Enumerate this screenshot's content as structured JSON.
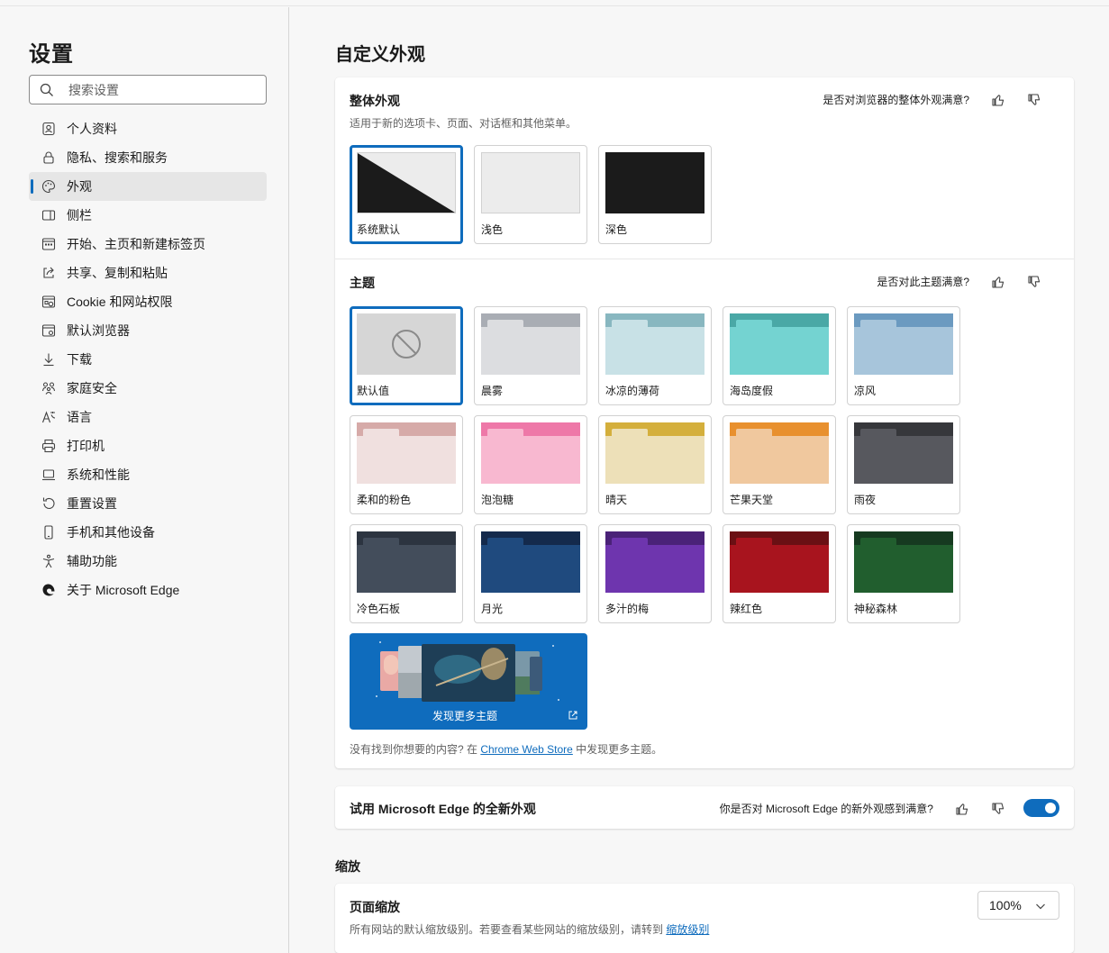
{
  "sidebar": {
    "title": "设置",
    "search_placeholder": "搜索设置",
    "items": [
      {
        "label": "个人资料",
        "icon": "profile-icon"
      },
      {
        "label": "隐私、搜索和服务",
        "icon": "lock-icon"
      },
      {
        "label": "外观",
        "icon": "palette-icon",
        "active": true
      },
      {
        "label": "侧栏",
        "icon": "sidebar-icon"
      },
      {
        "label": "开始、主页和新建标签页",
        "icon": "home-grid-icon"
      },
      {
        "label": "共享、复制和粘贴",
        "icon": "share-icon"
      },
      {
        "label": "Cookie 和网站权限",
        "icon": "cookie-icon"
      },
      {
        "label": "默认浏览器",
        "icon": "browser-icon"
      },
      {
        "label": "下载",
        "icon": "download-icon"
      },
      {
        "label": "家庭安全",
        "icon": "family-icon"
      },
      {
        "label": "语言",
        "icon": "language-icon"
      },
      {
        "label": "打印机",
        "icon": "printer-icon"
      },
      {
        "label": "系统和性能",
        "icon": "laptop-icon"
      },
      {
        "label": "重置设置",
        "icon": "reset-icon"
      },
      {
        "label": "手机和其他设备",
        "icon": "phone-icon"
      },
      {
        "label": "辅助功能",
        "icon": "accessibility-icon"
      },
      {
        "label": "关于 Microsoft Edge",
        "icon": "edge-logo-icon"
      }
    ]
  },
  "main": {
    "title": "自定义外观",
    "overall": {
      "title": "整体外观",
      "subtitle": "适用于新的选项卡、页面、对话框和其他菜单。",
      "feedback": "是否对浏览器的整体外观满意?",
      "options": [
        {
          "label": "系统默认",
          "selected": true
        },
        {
          "label": "浅色"
        },
        {
          "label": "深色"
        }
      ]
    },
    "themes": {
      "title": "主题",
      "feedback": "是否对此主题满意?",
      "items": [
        {
          "label": "默认值",
          "selected": true,
          "default": true
        },
        {
          "label": "晨雾",
          "bar": "#a9adb4",
          "body": "#dcdde0",
          "tab": "#dcdde0"
        },
        {
          "label": "冰凉的薄荷",
          "bar": "#88b7c0",
          "body": "#c8e1e6",
          "tab": "#c8e1e6"
        },
        {
          "label": "海岛度假",
          "bar": "#4aa8a6",
          "body": "#74d3d1",
          "tab": "#74d3d1"
        },
        {
          "label": "凉风",
          "bar": "#6b9ac0",
          "body": "#a7c5db",
          "tab": "#a7c5db"
        },
        {
          "label": "柔和的粉色",
          "bar": "#d6aaa8",
          "body": "#f0e0df",
          "tab": "#f0e0df"
        },
        {
          "label": "泡泡糖",
          "bar": "#ee78a8",
          "body": "#f8b8d0",
          "tab": "#f8b8d0"
        },
        {
          "label": "晴天",
          "bar": "#d4af3c",
          "body": "#ede0b8",
          "tab": "#ede0b8"
        },
        {
          "label": "芒果天堂",
          "bar": "#e8902e",
          "body": "#f0c89e",
          "tab": "#f0c89e"
        },
        {
          "label": "雨夜",
          "bar": "#36373b",
          "body": "#57585e",
          "tab": "#57585e"
        },
        {
          "label": "冷色石板",
          "bar": "#2c3440",
          "body": "#434d5b",
          "tab": "#434d5b"
        },
        {
          "label": "月光",
          "bar": "#142a4c",
          "body": "#1f4a7e",
          "tab": "#1f4a7e"
        },
        {
          "label": "多汁的梅",
          "bar": "#4a2278",
          "body": "#6e35ae",
          "tab": "#6e35ae"
        },
        {
          "label": "辣红色",
          "bar": "#6a1014",
          "body": "#a8141e",
          "tab": "#a8141e"
        },
        {
          "label": "神秘森林",
          "bar": "#163a20",
          "body": "#215e2e",
          "tab": "#215e2e"
        }
      ],
      "discover_label": "发现更多主题",
      "hint_prefix": "没有找到你想要的内容? 在 ",
      "hint_link": "Chrome Web Store",
      "hint_suffix": " 中发现更多主题。"
    },
    "new_look": {
      "title": "试用 Microsoft Edge 的全新外观",
      "feedback": "你是否对 Microsoft Edge 的新外观感到满意?",
      "enabled": true
    },
    "zoom": {
      "section_title": "缩放",
      "title": "页面缩放",
      "desc_prefix": "所有网站的默认缩放级别。若要查看某些网站的缩放级别，请转到 ",
      "desc_link": "缩放级别",
      "value": "100%"
    }
  },
  "colors": {
    "accent": "#0f6cbd",
    "dark_mode_preview": "#1b1b1b",
    "light_mode_preview": "#ececec"
  }
}
